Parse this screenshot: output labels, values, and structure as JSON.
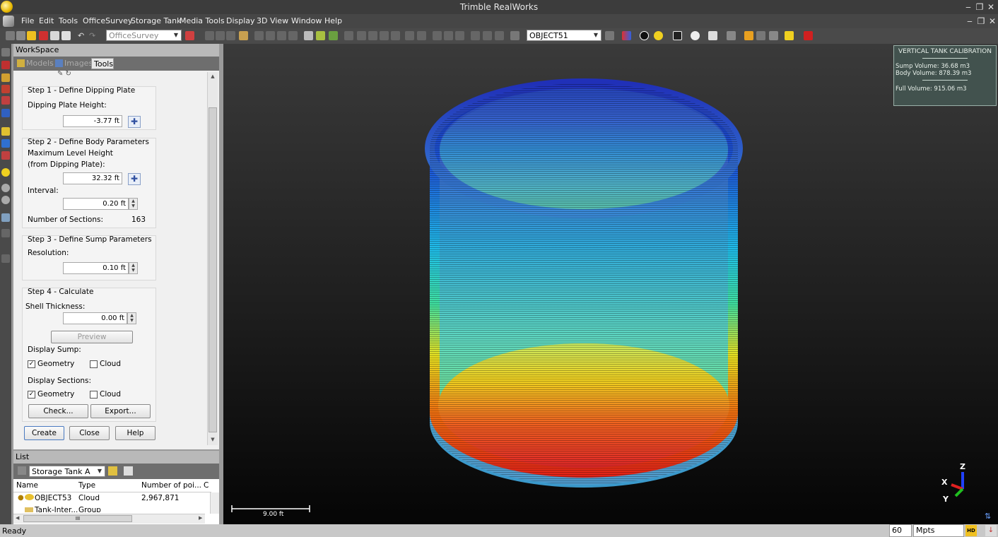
{
  "window": {
    "title": "Trimble RealWorks"
  },
  "menu": [
    "File",
    "Edit",
    "Tools",
    "OfficeSurvey",
    "Storage Tank",
    "Media Tools",
    "Display",
    "3D View",
    "Window",
    "Help"
  ],
  "toolbar": {
    "project_combo": "OfficeSurvey",
    "object_combo": "OBJECT51"
  },
  "workspace": {
    "title": "WorkSpace",
    "tabs": [
      "Models",
      "Images",
      "Tools"
    ],
    "step1": {
      "title": "Step 1 - Define Dipping Plate",
      "height_label": "Dipping Plate Height:",
      "height_value": "-3.77 ft"
    },
    "step2": {
      "title": "Step 2 - Define Body Parameters",
      "max_label_1": "Maximum Level Height",
      "max_label_2": "(from Dipping Plate):",
      "max_value": "32.32 ft",
      "interval_label": "Interval:",
      "interval_value": "0.20 ft",
      "sections_label": "Number of Sections:",
      "sections_value": "163"
    },
    "step3": {
      "title": "Step 3 - Define Sump Parameters",
      "resolution_label": "Resolution:",
      "resolution_value": "0.10 ft"
    },
    "step4": {
      "title": "Step 4 - Calculate",
      "shell_label": "Shell Thickness:",
      "shell_value": "0.00 ft",
      "preview": "Preview",
      "display_sump": "Display Sump:",
      "display_sections": "Display Sections:",
      "geometry": "Geometry",
      "cloud": "Cloud",
      "check": "Check...",
      "export": "Export..."
    },
    "buttons": {
      "create": "Create",
      "close": "Close",
      "help": "Help"
    }
  },
  "list": {
    "title": "List",
    "combo": "Storage Tank A",
    "columns": [
      "Name",
      "Type",
      "Number of poi...",
      "C"
    ],
    "rows": [
      {
        "name": "OBJECT53",
        "type": "Cloud",
        "points": "2,967,871"
      },
      {
        "name": "Tank-Inter...",
        "type": "Group",
        "points": ""
      }
    ],
    "hscroll": "III"
  },
  "calibration": {
    "title": "VERTICAL TANK CALIBRATION",
    "sump": "Sump Volume: 36.68 m3",
    "body": "Body Volume: 878.39 m3",
    "full": "Full Volume: 915.06 m3"
  },
  "viewport": {
    "scale_label": "9.00 ft",
    "axis_z": "Z",
    "axis_x": "X",
    "axis_y": "Y"
  },
  "status": {
    "text": "Ready",
    "count": "60",
    "unit": "Mpts",
    "hd": "HD"
  },
  "colors": {
    "accent_yellow": "#f0c020",
    "panel": "#f0f0f0",
    "chrome": "#464646"
  }
}
